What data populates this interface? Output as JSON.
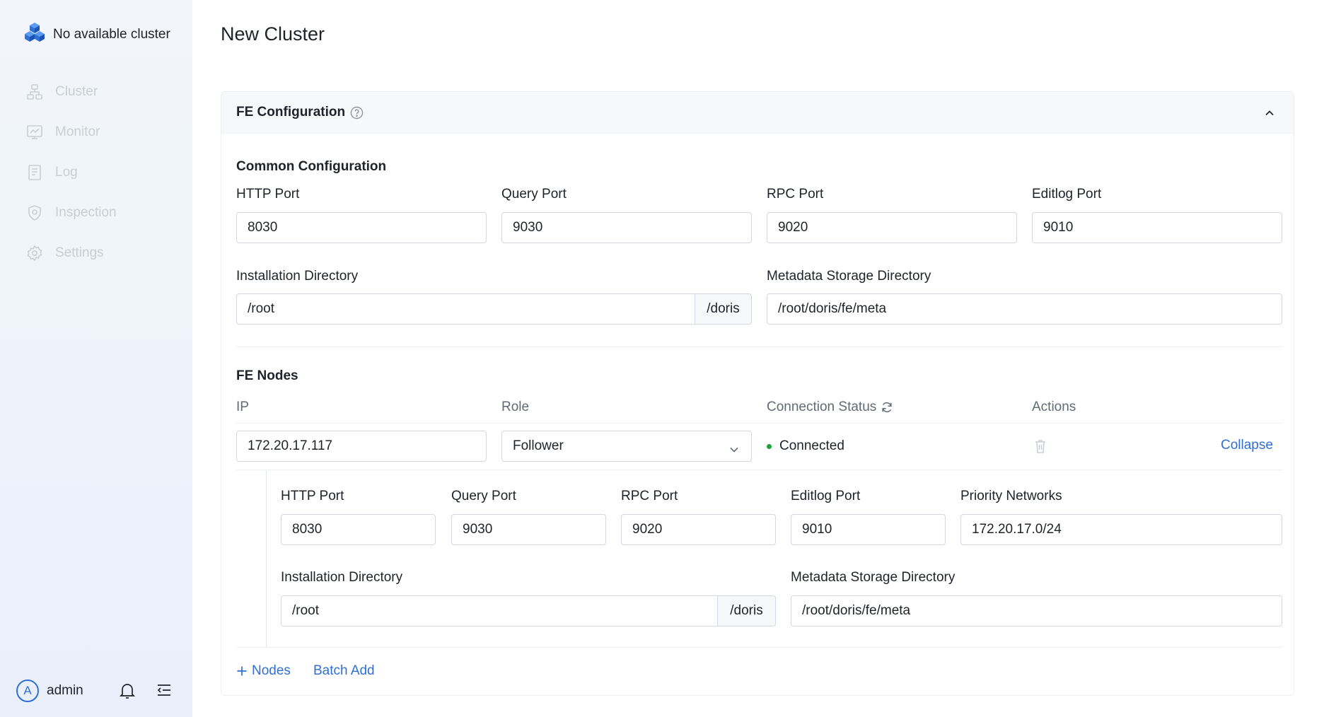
{
  "sidebar": {
    "brand_title": "No available cluster",
    "items": [
      {
        "label": "Cluster",
        "icon": "cluster-icon"
      },
      {
        "label": "Monitor",
        "icon": "monitor-icon"
      },
      {
        "label": "Log",
        "icon": "log-icon"
      },
      {
        "label": "Inspection",
        "icon": "shield-icon"
      },
      {
        "label": "Settings",
        "icon": "gear-icon"
      }
    ],
    "user": {
      "avatar_initial": "A",
      "name": "admin"
    }
  },
  "page": {
    "title": "New Cluster"
  },
  "fe_config": {
    "header_title": "FE Configuration",
    "common": {
      "title": "Common Configuration",
      "http_port_label": "HTTP Port",
      "http_port_value": "8030",
      "query_port_label": "Query Port",
      "query_port_value": "9030",
      "rpc_port_label": "RPC Port",
      "rpc_port_value": "9020",
      "editlog_port_label": "Editlog Port",
      "editlog_port_value": "9010",
      "install_dir_label": "Installation Directory",
      "install_dir_value": "/root",
      "install_dir_suffix": "/doris",
      "meta_dir_label": "Metadata Storage Directory",
      "meta_dir_value": "/root/doris/fe/meta"
    },
    "nodes": {
      "title": "FE Nodes",
      "columns": {
        "ip": "IP",
        "role": "Role",
        "status": "Connection Status",
        "actions": "Actions"
      },
      "rows": [
        {
          "ip": "172.20.17.117",
          "role": "Follower",
          "status": "Connected",
          "collapse_label": "Collapse",
          "detail": {
            "http_port_label": "HTTP Port",
            "http_port_value": "8030",
            "query_port_label": "Query Port",
            "query_port_value": "9030",
            "rpc_port_label": "RPC Port",
            "rpc_port_value": "9020",
            "editlog_port_label": "Editlog Port",
            "editlog_port_value": "9010",
            "priority_networks_label": "Priority Networks",
            "priority_networks_value": "172.20.17.0/24",
            "install_dir_label": "Installation Directory",
            "install_dir_value": "/root",
            "install_dir_suffix": "/doris",
            "meta_dir_label": "Metadata Storage Directory",
            "meta_dir_value": "/root/doris/fe/meta"
          }
        }
      ],
      "add_nodes_label": "Nodes",
      "batch_add_label": "Batch Add"
    }
  },
  "colors": {
    "accent": "#2f6fd6",
    "success": "#1aa33b",
    "muted": "#c9ced6"
  }
}
